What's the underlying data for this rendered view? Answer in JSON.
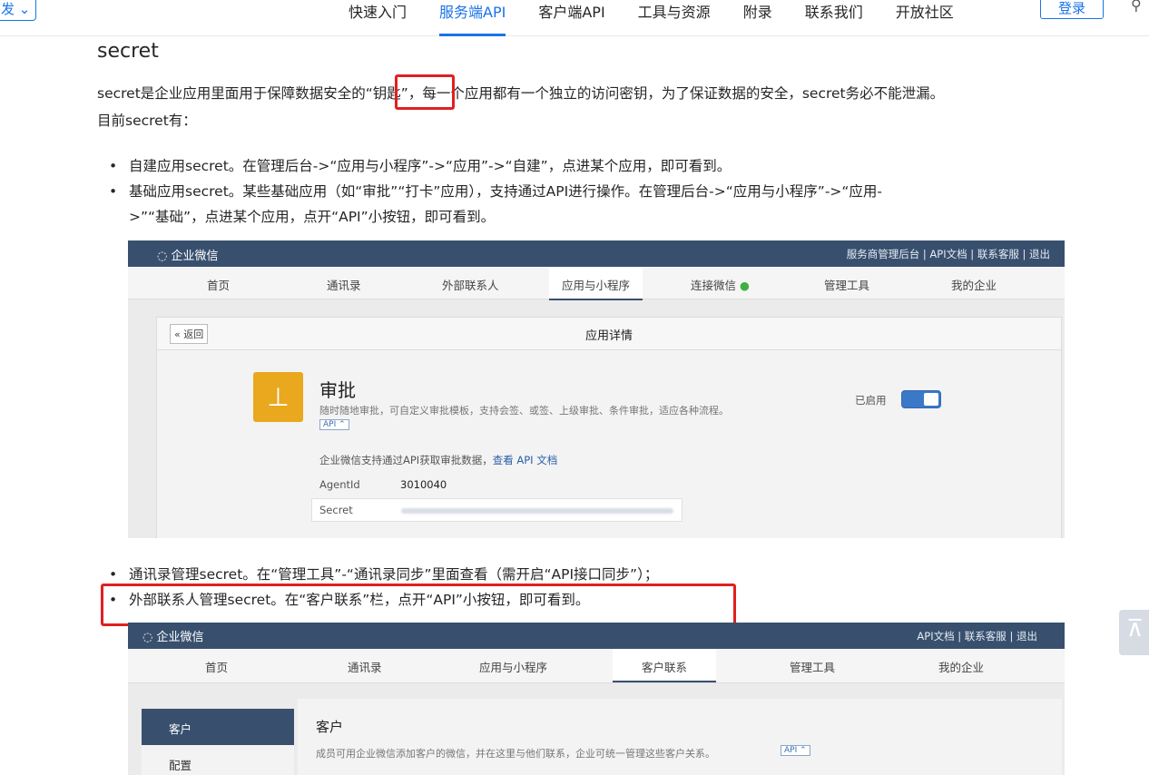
{
  "topnav": {
    "version_label": "发 ⌄",
    "links": [
      "快速入门",
      "服务端API",
      "客户端API",
      "工具与资源",
      "附录",
      "联系我们",
      "开放社区"
    ],
    "active_index": 1,
    "login_label": "登录",
    "search_icon": "search-icon"
  },
  "article": {
    "heading": "secret",
    "para_line1_a": "secret是企业应用里面用于保障数据安全的",
    "para_line1_key": "“钥匙”",
    "para_line1_b": "，每一个应用都有一个独立的访问密钥，为了保证数据的安全，secret务必不能泄漏。",
    "para_line2": "目前secret有：",
    "bullets1": [
      "自建应用secret。在管理后台->“应用与小程序”->“应用”->“自建”，点进某个应用，即可看到。",
      "基础应用secret。某些基础应用（如“审批”“打卡”应用），支持通过API进行操作。在管理后台->“应用与小程序”->“应用-",
      ">”“基础”，点进某个应用，点开“API”小按钮，即可看到。"
    ],
    "bullets2": [
      "通讯录管理secret。在“管理工具”-“通讯录同步”里面查看（需开启“API接口同步”）；",
      "外部联系人管理secret。在“客户联系”栏，点开“API”小按钮，即可看到。"
    ]
  },
  "shot1": {
    "logo": "企业微信",
    "toplinks": "服务商管理后台 | API文档 | 联系客服 | 退出",
    "nav": [
      "首页",
      "通讯录",
      "外部联系人",
      "应用与小程序",
      "连接微信",
      "管理工具",
      "我的企业"
    ],
    "back": "« 返回",
    "panel_title": "应用详情",
    "app_name": "审批",
    "app_desc": "随时随地审批，可自定义审批模板，支持会签、或签、上级审批、条件审批，适应各种流程。",
    "api_tag": "API ⌃",
    "enabled_label": "已启用",
    "api_note": "企业微信支持通过API获取审批数据，",
    "api_link": "查看 API 文档",
    "agentid_label": "AgentId",
    "agentid_value": "3010040",
    "secret_label": "Secret"
  },
  "shot2": {
    "logo": "企业微信",
    "toplinks": "API文档 | 联系客服 | 退出",
    "nav": [
      "首页",
      "通讯录",
      "应用与小程序",
      "客户联系",
      "管理工具",
      "我的企业"
    ],
    "side_items": [
      "客户",
      "配置"
    ],
    "title": "客户",
    "desc": "成员可用企业微信添加客户的微信，并在这里与他们联系，企业可统一管理这些客户关系。",
    "api_tag": "API ⌃"
  },
  "totop_label": "⊼",
  "colors": {
    "accent": "#1a73e8",
    "highlight": "#e02020",
    "admin_header": "#38506e"
  }
}
